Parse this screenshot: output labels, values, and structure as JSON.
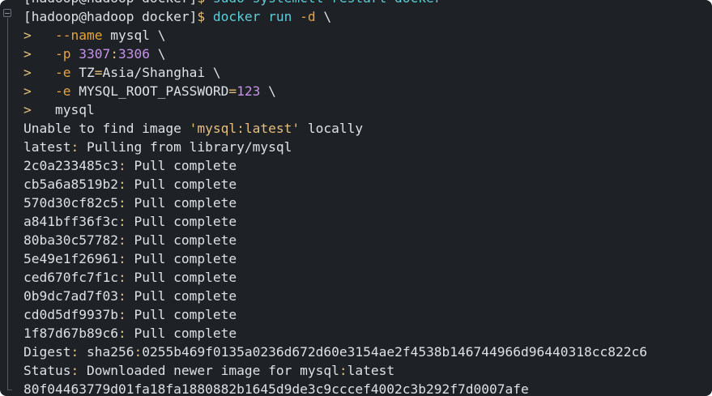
{
  "terminal": {
    "lines": [
      {
        "segments": [
          {
            "text": "[hadoop@hadoop docker]",
            "style": "plain"
          },
          {
            "text": "$ ",
            "style": "sep"
          },
          {
            "text": "sudo systemctl restart docker",
            "style": "cmd"
          }
        ]
      },
      {
        "segments": [
          {
            "text": "[hadoop@hadoop docker]",
            "style": "plain"
          },
          {
            "text": "$ ",
            "style": "sep"
          },
          {
            "text": "docker run ",
            "style": "cmd"
          },
          {
            "text": "-d",
            "style": "flag"
          },
          {
            "text": " \\",
            "style": "plain"
          }
        ]
      },
      {
        "segments": [
          {
            "text": ">   ",
            "style": "cont"
          },
          {
            "text": "--name",
            "style": "flag"
          },
          {
            "text": " mysql \\",
            "style": "plain"
          }
        ]
      },
      {
        "segments": [
          {
            "text": ">   ",
            "style": "cont"
          },
          {
            "text": "-p",
            "style": "flag"
          },
          {
            "text": " ",
            "style": "plain"
          },
          {
            "text": "3307",
            "style": "num"
          },
          {
            "text": ":",
            "style": "sep"
          },
          {
            "text": "3306",
            "style": "num"
          },
          {
            "text": " \\",
            "style": "plain"
          }
        ]
      },
      {
        "segments": [
          {
            "text": ">   ",
            "style": "cont"
          },
          {
            "text": "-e",
            "style": "flag"
          },
          {
            "text": " TZ",
            "style": "plain"
          },
          {
            "text": "=",
            "style": "sep"
          },
          {
            "text": "Asia/Shanghai \\",
            "style": "plain"
          }
        ]
      },
      {
        "segments": [
          {
            "text": ">   ",
            "style": "cont"
          },
          {
            "text": "-e",
            "style": "flag"
          },
          {
            "text": " MYSQL_ROOT_PASSWORD",
            "style": "plain"
          },
          {
            "text": "=",
            "style": "sep"
          },
          {
            "text": "123",
            "style": "num"
          },
          {
            "text": " \\",
            "style": "plain"
          }
        ]
      },
      {
        "segments": [
          {
            "text": ">   ",
            "style": "cont"
          },
          {
            "text": "mysql",
            "style": "plain"
          }
        ]
      },
      {
        "segments": [
          {
            "text": "Unable to find image ",
            "style": "plain"
          },
          {
            "text": "'mysql:latest'",
            "style": "str"
          },
          {
            "text": " locally",
            "style": "plain"
          }
        ]
      },
      {
        "segments": [
          {
            "text": "latest",
            "style": "plain"
          },
          {
            "text": ":",
            "style": "sep"
          },
          {
            "text": " Pulling from library/mysql",
            "style": "plain"
          }
        ]
      },
      {
        "segments": [
          {
            "text": "2c0a233485c3",
            "style": "plain"
          },
          {
            "text": ":",
            "style": "sep"
          },
          {
            "text": " Pull complete",
            "style": "plain"
          }
        ]
      },
      {
        "segments": [
          {
            "text": "cb5a6a8519b2",
            "style": "plain"
          },
          {
            "text": ":",
            "style": "sep"
          },
          {
            "text": " Pull complete",
            "style": "plain"
          }
        ]
      },
      {
        "segments": [
          {
            "text": "570d30cf82c5",
            "style": "plain"
          },
          {
            "text": ":",
            "style": "sep"
          },
          {
            "text": " Pull complete",
            "style": "plain"
          }
        ]
      },
      {
        "segments": [
          {
            "text": "a841bff36f3c",
            "style": "plain"
          },
          {
            "text": ":",
            "style": "sep"
          },
          {
            "text": " Pull complete",
            "style": "plain"
          }
        ]
      },
      {
        "segments": [
          {
            "text": "80ba30c57782",
            "style": "plain"
          },
          {
            "text": ":",
            "style": "sep"
          },
          {
            "text": " Pull complete",
            "style": "plain"
          }
        ]
      },
      {
        "segments": [
          {
            "text": "5e49e1f26961",
            "style": "plain"
          },
          {
            "text": ":",
            "style": "sep"
          },
          {
            "text": " Pull complete",
            "style": "plain"
          }
        ]
      },
      {
        "segments": [
          {
            "text": "ced670fc7f1c",
            "style": "plain"
          },
          {
            "text": ":",
            "style": "sep"
          },
          {
            "text": " Pull complete",
            "style": "plain"
          }
        ]
      },
      {
        "segments": [
          {
            "text": "0b9dc7ad7f03",
            "style": "plain"
          },
          {
            "text": ":",
            "style": "sep"
          },
          {
            "text": " Pull complete",
            "style": "plain"
          }
        ]
      },
      {
        "segments": [
          {
            "text": "cd0d5df9937b",
            "style": "plain"
          },
          {
            "text": ":",
            "style": "sep"
          },
          {
            "text": " Pull complete",
            "style": "plain"
          }
        ]
      },
      {
        "segments": [
          {
            "text": "1f87d67b89c6",
            "style": "plain"
          },
          {
            "text": ":",
            "style": "sep"
          },
          {
            "text": " Pull complete",
            "style": "plain"
          }
        ]
      },
      {
        "segments": [
          {
            "text": "Digest",
            "style": "plain"
          },
          {
            "text": ":",
            "style": "sep"
          },
          {
            "text": " sha256",
            "style": "plain"
          },
          {
            "text": ":",
            "style": "sep"
          },
          {
            "text": "0255b469f0135a0236d672d60e3154ae2f4538b146744966d96440318cc822c6",
            "style": "plain"
          }
        ]
      },
      {
        "segments": [
          {
            "text": "Status",
            "style": "plain"
          },
          {
            "text": ":",
            "style": "sep"
          },
          {
            "text": " Downloaded newer image for mysql",
            "style": "plain"
          },
          {
            "text": ":",
            "style": "sep"
          },
          {
            "text": "latest",
            "style": "plain"
          }
        ]
      },
      {
        "segments": [
          {
            "text": "80f04463779d01fa18fa1880882b1645d9de3c9cccef4002c3b292f7d0007afe",
            "style": "plain"
          }
        ]
      }
    ]
  },
  "icons": {
    "fold_toggle": "collapse-icon"
  },
  "colors": {
    "background": "#1e2126",
    "text": "#dde1e6",
    "command": "#5ccdd9",
    "flag": "#e8a33d",
    "number": "#c792ea",
    "string": "#e5c07b"
  }
}
